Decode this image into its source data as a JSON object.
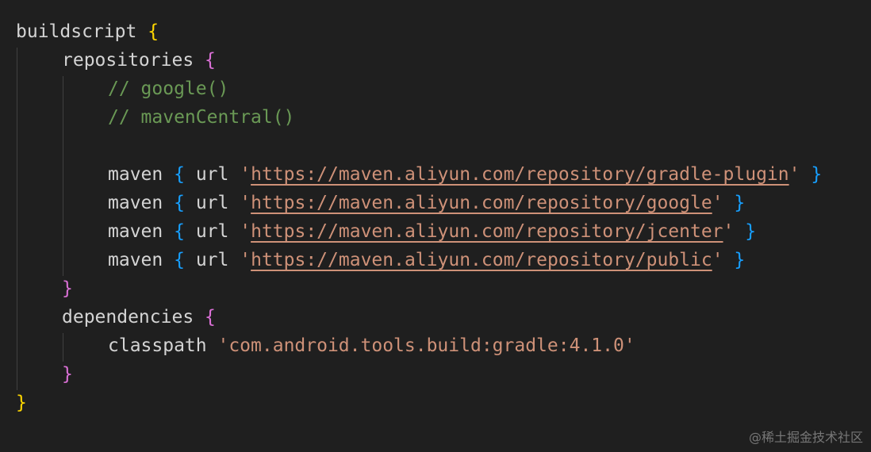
{
  "code": {
    "line1": {
      "kw": "buildscript",
      "open": "{"
    },
    "line2": {
      "kw": "repositories",
      "open": "{"
    },
    "line3": {
      "comment": "// google()"
    },
    "line4": {
      "comment": "// mavenCentral()"
    },
    "line6": {
      "kw": "maven",
      "open": "{",
      "url_kw": "url",
      "q1": "'",
      "url": "https://maven.aliyun.com/repository/gradle-plugin",
      "q2": "'",
      "close": "}"
    },
    "line7": {
      "kw": "maven",
      "open": "{",
      "url_kw": "url",
      "q1": "'",
      "url": "https://maven.aliyun.com/repository/google",
      "q2": "'",
      "close": "}"
    },
    "line8": {
      "kw": "maven",
      "open": "{",
      "url_kw": "url",
      "q1": "'",
      "url": "https://maven.aliyun.com/repository/jcenter",
      "q2": "'",
      "close": "}"
    },
    "line9": {
      "kw": "maven",
      "open": "{",
      "url_kw": "url",
      "q1": "'",
      "url": "https://maven.aliyun.com/repository/public",
      "q2": "'",
      "close": "}"
    },
    "line10": {
      "close": "}"
    },
    "line11": {
      "kw": "dependencies",
      "open": "{"
    },
    "line12": {
      "kw": "classpath",
      "str": "'com.android.tools.build:gradle:4.1.0'"
    },
    "line13": {
      "close": "}"
    },
    "line14": {
      "close": "}"
    }
  },
  "watermark": "@稀土掘金技术社区",
  "colors": {
    "background": "#1f1f1f",
    "text": "#d4d4d4",
    "comment": "#6a9955",
    "string": "#ce9178",
    "brace_level1": "#ffd700",
    "brace_level2": "#da70d6",
    "brace_level3": "#179fff"
  }
}
